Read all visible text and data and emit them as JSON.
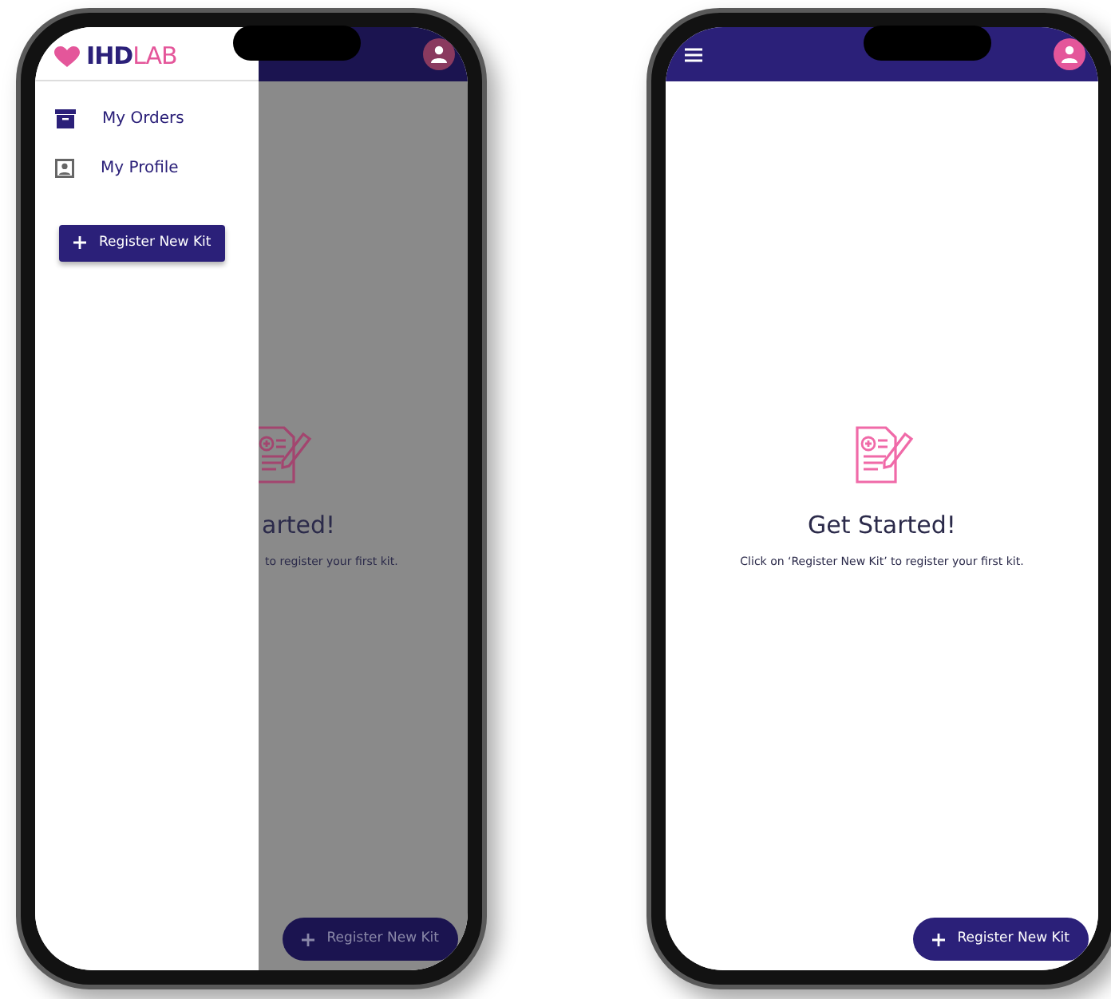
{
  "screens": [
    {
      "dimmed": true,
      "drawer": {
        "logo": {
          "brand_bold": "IHD",
          "brand_light": "LAB"
        },
        "items": [
          {
            "label": "My Orders"
          },
          {
            "label": "My Profile"
          }
        ],
        "button": {
          "label": "Register New Kit"
        }
      },
      "empty_state": {
        "title": "arted!",
        "message": "to register your first kit."
      },
      "fab": {
        "label": "Register New Kit"
      }
    },
    {
      "dimmed": false,
      "empty_state": {
        "title": "Get Started!",
        "message": "Click on ‘Register New Kit’ to register your first kit."
      },
      "fab": {
        "label": "Register New Kit"
      }
    }
  ]
}
